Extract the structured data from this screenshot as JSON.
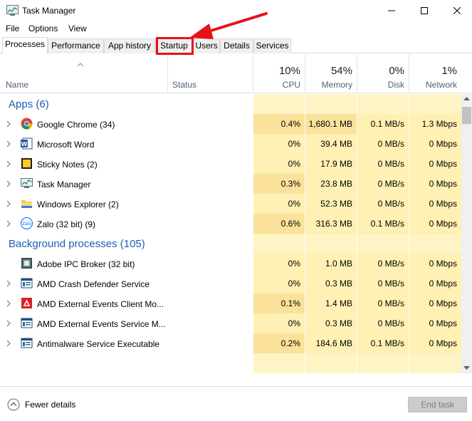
{
  "window": {
    "title": "Task Manager"
  },
  "menu": [
    "File",
    "Options",
    "View"
  ],
  "tabs": [
    "Processes",
    "Performance",
    "App history",
    "Startup",
    "Users",
    "Details",
    "Services"
  ],
  "columns": {
    "name": "Name",
    "status": "Status",
    "cpu": {
      "pct": "10%",
      "label": "CPU"
    },
    "memory": {
      "pct": "54%",
      "label": "Memory"
    },
    "disk": {
      "pct": "0%",
      "label": "Disk"
    },
    "network": {
      "pct": "1%",
      "label": "Network"
    }
  },
  "groups": {
    "apps": "Apps (6)",
    "background": "Background processes (105)"
  },
  "apps": [
    {
      "name": "Google Chrome (34)",
      "icon": "chrome-icon",
      "cpu": "0.4%",
      "mem": "1,680.1 MB",
      "disk": "0.1 MB/s",
      "net": "1.3 Mbps"
    },
    {
      "name": "Microsoft Word",
      "icon": "word-icon",
      "cpu": "0%",
      "mem": "39.4 MB",
      "disk": "0 MB/s",
      "net": "0 Mbps"
    },
    {
      "name": "Sticky Notes (2)",
      "icon": "sticky-notes-icon",
      "cpu": "0%",
      "mem": "17.9 MB",
      "disk": "0 MB/s",
      "net": "0 Mbps"
    },
    {
      "name": "Task Manager",
      "icon": "task-manager-icon",
      "cpu": "0.3%",
      "mem": "23.8 MB",
      "disk": "0 MB/s",
      "net": "0 Mbps"
    },
    {
      "name": "Windows Explorer (2)",
      "icon": "folder-icon",
      "cpu": "0%",
      "mem": "52.3 MB",
      "disk": "0 MB/s",
      "net": "0 Mbps"
    },
    {
      "name": "Zalo (32 bit) (9)",
      "icon": "zalo-icon",
      "cpu": "0.6%",
      "mem": "316.3 MB",
      "disk": "0.1 MB/s",
      "net": "0 Mbps"
    }
  ],
  "background": [
    {
      "name": "Adobe IPC Broker (32 bit)",
      "icon": "adobe-ipc-icon",
      "cpu": "0%",
      "mem": "1.0 MB",
      "disk": "0 MB/s",
      "net": "0 Mbps"
    },
    {
      "name": "AMD Crash Defender Service",
      "icon": "service-icon",
      "cpu": "0%",
      "mem": "0.3 MB",
      "disk": "0 MB/s",
      "net": "0 Mbps"
    },
    {
      "name": "AMD External Events Client Mo...",
      "icon": "amd-icon",
      "cpu": "0.1%",
      "mem": "1.4 MB",
      "disk": "0 MB/s",
      "net": "0 Mbps"
    },
    {
      "name": "AMD External Events Service M...",
      "icon": "service-icon",
      "cpu": "0%",
      "mem": "0.3 MB",
      "disk": "0 MB/s",
      "net": "0 Mbps"
    },
    {
      "name": "Antimalware Service Executable",
      "icon": "service-icon",
      "cpu": "0.2%",
      "mem": "184.6 MB",
      "disk": "0.1 MB/s",
      "net": "0 Mbps"
    }
  ],
  "footer": {
    "fewer_details": "Fewer details",
    "end_task": "End task"
  },
  "colors": {
    "accent_blue": "#1b5fb5",
    "highlight_red": "#e8121b",
    "heat_light": "#fff4c4",
    "heat_medium": "#fbe29a"
  }
}
